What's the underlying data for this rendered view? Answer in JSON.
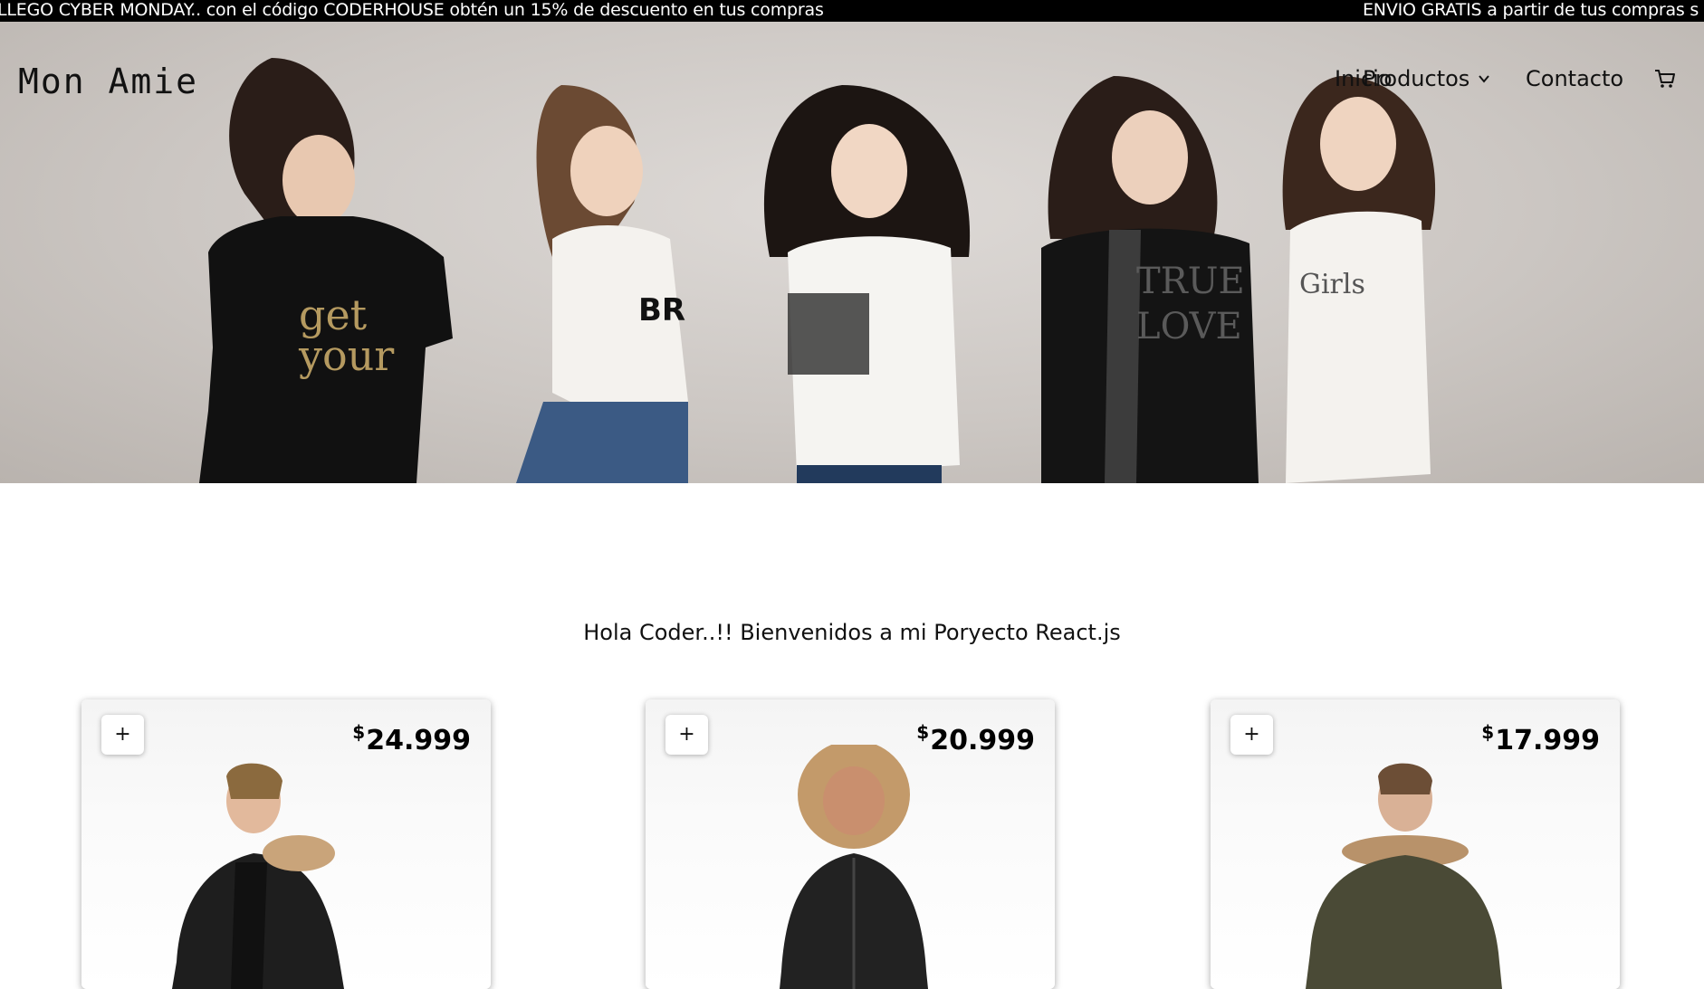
{
  "promo": {
    "message_1": "LLEGO CYBER MONDAY.. con el código CODERHOUSE obtén un 15% de descuento en tus compras",
    "message_2": "ENVIO GRATIS a partir de tus compras s"
  },
  "header": {
    "logo": "Mon Amie",
    "nav": {
      "inicio": "Inicio",
      "productos": "Productos",
      "contacto": "Contacto"
    },
    "icons": [
      "chevron-down-icon",
      "cart-icon"
    ]
  },
  "welcome_text": "Hola Coder..!! Bienvenidos a mi Poryecto React.js",
  "products": [
    {
      "add_label": "+",
      "currency": "$",
      "price": "24.999",
      "jacket_color": "#1e1e1e"
    },
    {
      "add_label": "+",
      "currency": "$",
      "price": "20.999",
      "jacket_color": "#222222"
    },
    {
      "add_label": "+",
      "currency": "$",
      "price": "17.999",
      "jacket_color": "#4a4a36"
    }
  ]
}
